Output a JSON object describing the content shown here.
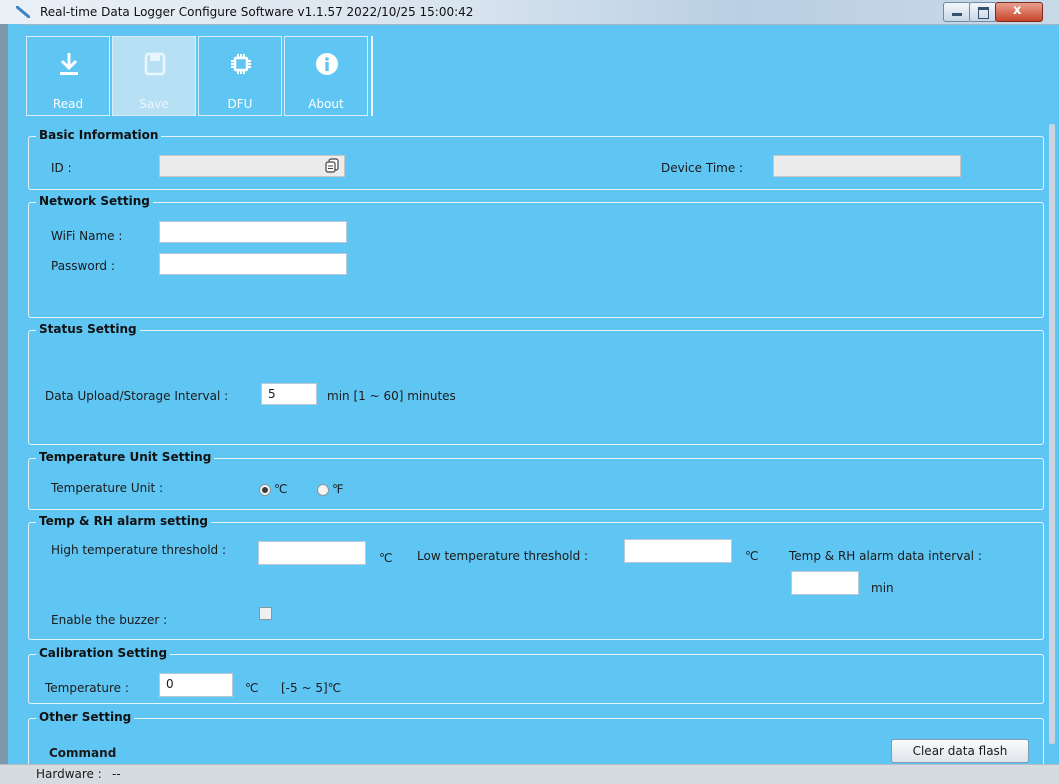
{
  "window": {
    "title": "Real-time Data Logger Configure Software v1.1.57  2022/10/25 15:00:42",
    "close_glyph": "x"
  },
  "toolbar": {
    "buttons": [
      {
        "label": "Read",
        "icon": "download-icon",
        "enabled": true
      },
      {
        "label": "Save",
        "icon": "floppy-disk-icon",
        "enabled": false
      },
      {
        "label": "DFU",
        "icon": "chip-icon",
        "enabled": true
      },
      {
        "label": "About",
        "icon": "info-icon",
        "enabled": true
      }
    ]
  },
  "basic_info": {
    "title": "Basic Information",
    "id_label": "ID :",
    "id_value": "",
    "device_time_label": "Device Time :",
    "device_time_value": ""
  },
  "network": {
    "title": "Network Setting",
    "wifi_label": "WiFi Name :",
    "wifi_value": "",
    "password_label": "Password :",
    "password_value": ""
  },
  "status": {
    "title": "Status Setting",
    "interval_label": "Data Upload/Storage Interval :",
    "interval_value": "5",
    "interval_unit": "min  [1 ~ 60] minutes"
  },
  "temp_unit": {
    "title": "Temperature Unit Setting",
    "label": "Temperature Unit :",
    "celsius": "℃",
    "fahrenheit": "℉",
    "selected": "celsius"
  },
  "alarm": {
    "title": "Temp & RH alarm setting",
    "high_label": "High temperature threshold :",
    "high_value": "",
    "high_unit": "℃",
    "low_label": "Low temperature threshold :",
    "low_value": "",
    "low_unit": "℃",
    "interval_label": "Temp & RH alarm data interval :",
    "interval_value": "",
    "interval_unit": "min",
    "buzzer_label": "Enable the buzzer :",
    "buzzer_checked": false
  },
  "calibration": {
    "title": "Calibration Setting",
    "temp_label": "Temperature :",
    "temp_value": "0",
    "temp_unit": "℃",
    "temp_range": "[-5 ~ 5]℃"
  },
  "other": {
    "title": "Other Setting",
    "command_label": "Command",
    "clear_button": "Clear data flash"
  },
  "statusbar": {
    "hardware_label": "Hardware :",
    "hardware_value": "--"
  }
}
